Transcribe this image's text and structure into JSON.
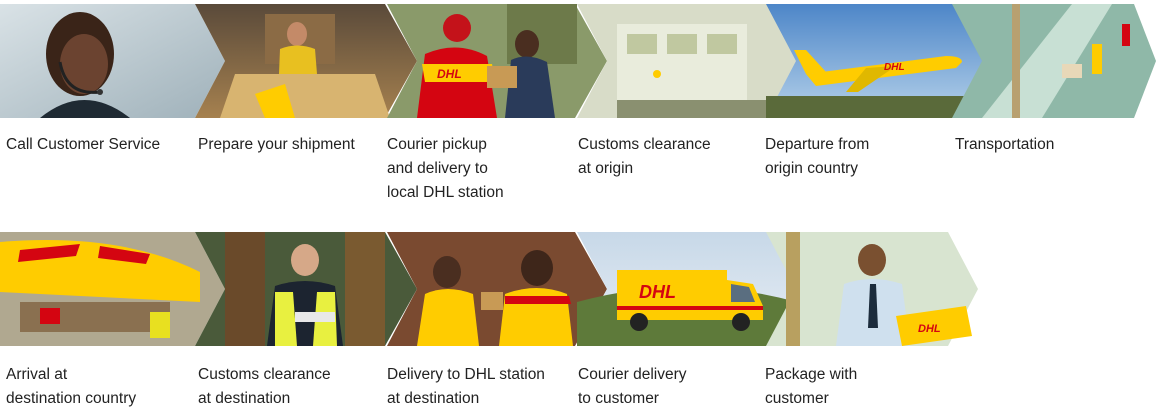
{
  "colors": {
    "dhl_yellow": "#ffcc00",
    "dhl_red": "#d40511",
    "caption_text": "#222222",
    "background": "#ffffff"
  },
  "steps_row1": [
    {
      "lines": [
        "Call Customer Service"
      ],
      "image": "customer-service-agent-headset-photo"
    },
    {
      "lines": [
        "Prepare your shipment"
      ],
      "image": "woman-preparing-boxes-photo"
    },
    {
      "lines": [
        "Courier pickup",
        "and delivery to",
        "local DHL station"
      ],
      "image": "courier-handing-package-photo"
    },
    {
      "lines": [
        "Customs clearance",
        "at origin"
      ],
      "image": "customs-office-photo"
    },
    {
      "lines": [
        "Departure from",
        "origin country"
      ],
      "image": "dhl-airplane-photo"
    },
    {
      "lines": [
        "Transportation"
      ],
      "image": "sorting-conveyor-photo"
    }
  ],
  "steps_row2": [
    {
      "lines": [
        "Arrival at",
        "destination country"
      ],
      "image": "cargo-unloading-airplane-photo"
    },
    {
      "lines": [
        "Customs clearance",
        "at destination"
      ],
      "image": "customs-officer-warehouse-photo"
    },
    {
      "lines": [
        "Delivery to DHL station",
        "at destination"
      ],
      "image": "dhl-staff-packages-photo"
    },
    {
      "lines": [
        "Courier delivery",
        "to customer"
      ],
      "image": "dhl-van-photo"
    },
    {
      "lines": [
        "Package with",
        "customer"
      ],
      "image": "customer-receiving-package-photo"
    }
  ]
}
